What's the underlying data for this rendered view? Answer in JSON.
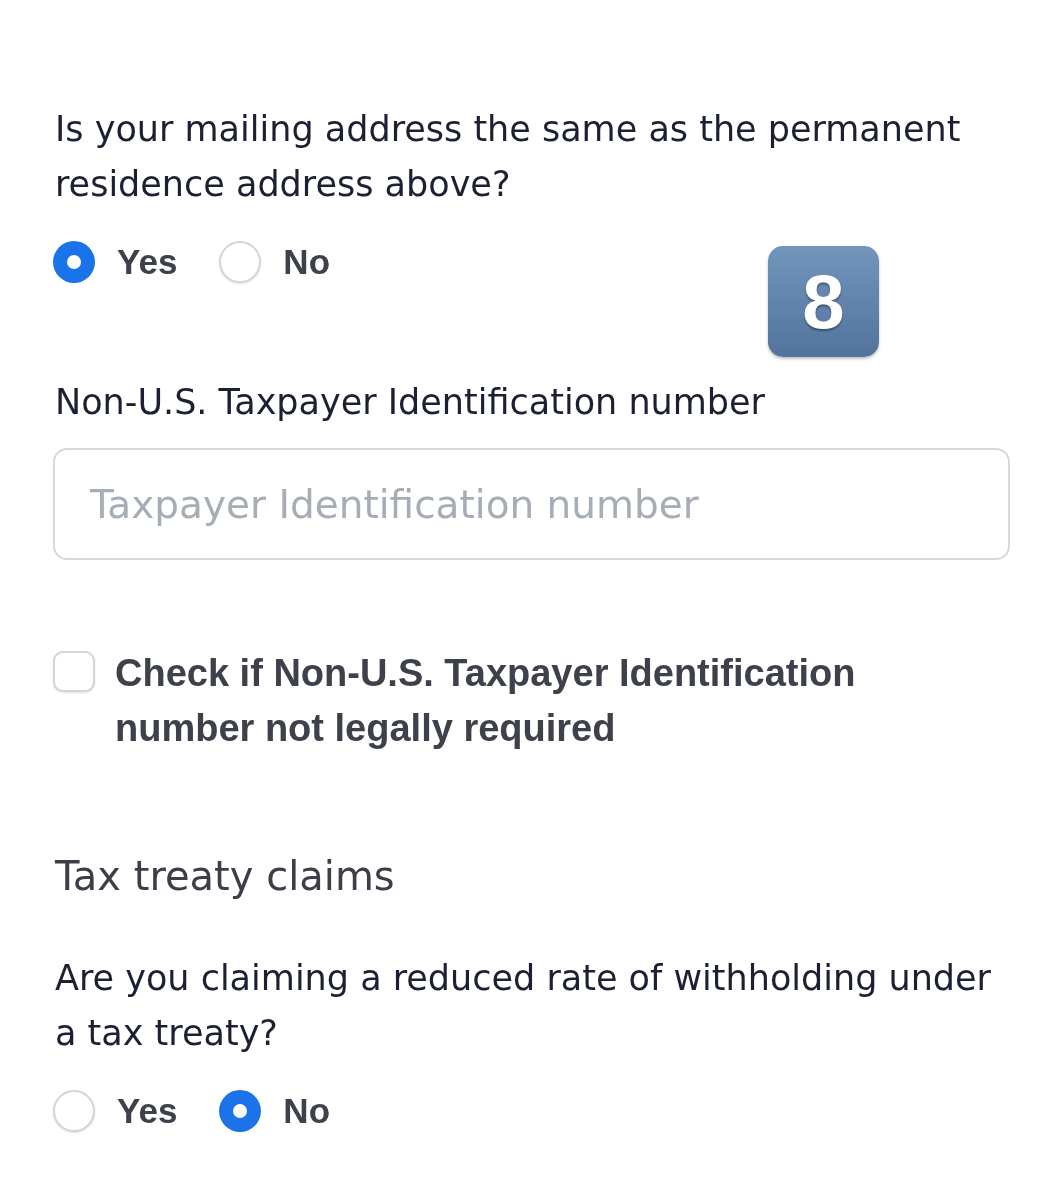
{
  "mailing_question": {
    "text": "Is your mailing address the same as the permanent residence address above?",
    "options": [
      {
        "label": "Yes",
        "selected": true
      },
      {
        "label": "No",
        "selected": false
      }
    ]
  },
  "keycap_badge": {
    "text": "8"
  },
  "tin_field": {
    "label": "Non-U.S. Taxpayer Identification number",
    "placeholder": "Taxpayer Identification number"
  },
  "tin_not_required": {
    "label": "Check if Non-U.S. Taxpayer Identification number not legally required",
    "checked": false
  },
  "tax_treaty": {
    "heading": "Tax treaty claims",
    "question": {
      "text": "Are you claiming a reduced rate of withholding under a tax treaty?",
      "options": [
        {
          "label": "Yes",
          "selected": false
        },
        {
          "label": "No",
          "selected": true
        }
      ]
    }
  }
}
